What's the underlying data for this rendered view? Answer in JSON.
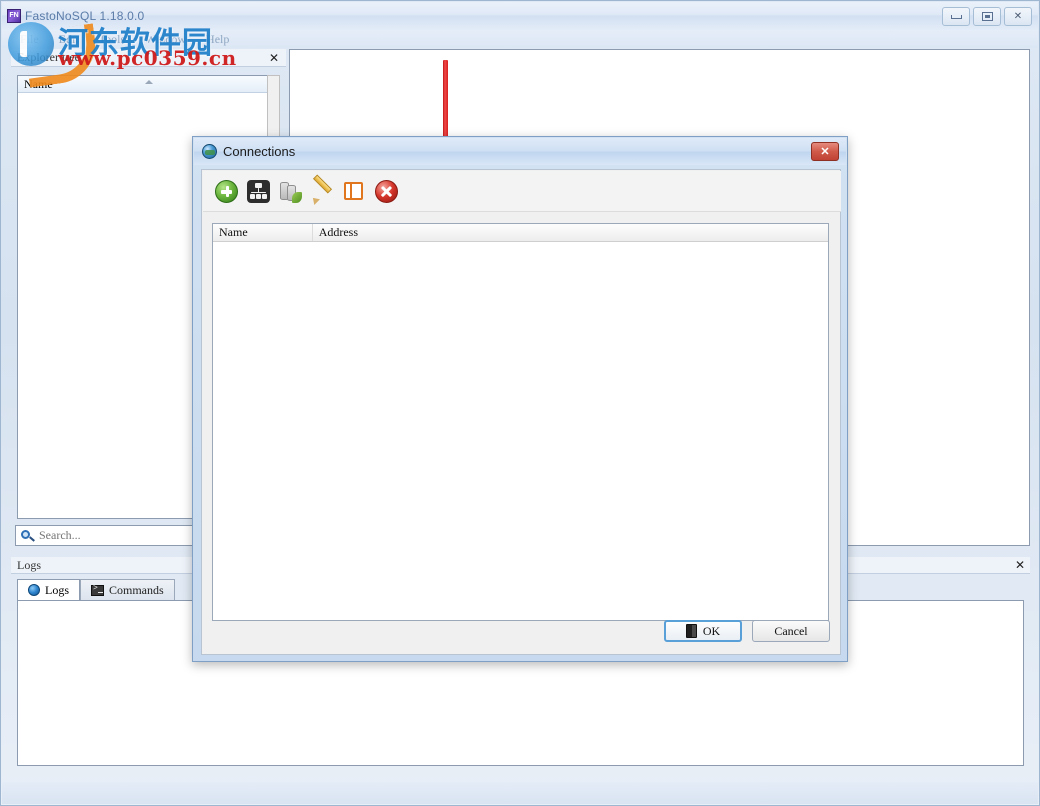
{
  "app": {
    "title": "FastoNoSQL 1.18.0.0",
    "title_icon": "app-icon",
    "window_controls": {
      "minimize": "minimize-button",
      "maximize": "maximize-button",
      "close_label": "✕"
    },
    "menu": [
      {
        "label": "File"
      },
      {
        "label": "Edit"
      },
      {
        "label": "Tools"
      },
      {
        "label": "Window"
      },
      {
        "label": "Help"
      }
    ]
  },
  "explorer": {
    "title": "Explorer tree",
    "close_label": "✕",
    "column_header": "Name",
    "rows": []
  },
  "search": {
    "value": "",
    "placeholder": "Search...",
    "icon": "search-icon"
  },
  "logs_panel": {
    "title": "Logs",
    "close_label": "✕",
    "tabs": [
      {
        "label": "Logs",
        "icon": "logs-icon",
        "active": true
      },
      {
        "label": "Commands",
        "icon": "console-icon",
        "active": false
      }
    ],
    "content": ""
  },
  "status_bar": {
    "text": ""
  },
  "watermark": {
    "site_name": "河东软件园",
    "url": "www.pc0359.cn",
    "brand_color": "#1d7ec9",
    "url_color": "#cf1b1b"
  },
  "annotation": {
    "type": "down-arrow",
    "color": "#de1f1f"
  },
  "dialog": {
    "title": "Connections",
    "icon": "globe-icon",
    "close_label": "✕",
    "toolbar": [
      {
        "name": "add-connection",
        "icon": "add-icon",
        "tooltip": "Add connection"
      },
      {
        "name": "add-cluster",
        "icon": "cluster-icon",
        "tooltip": "Add cluster"
      },
      {
        "name": "add-sentinel",
        "icon": "sentinel-icon",
        "tooltip": "Add sentinel"
      },
      {
        "name": "edit-connection",
        "icon": "pencil-icon",
        "tooltip": "Edit connection"
      },
      {
        "name": "clone-connection",
        "icon": "clone-icon",
        "tooltip": "Clone connection"
      },
      {
        "name": "remove-connection",
        "icon": "remove-icon",
        "tooltip": "Remove connection"
      }
    ],
    "table": {
      "columns": [
        "Name",
        "Address"
      ],
      "rows": []
    },
    "buttons": {
      "ok": "OK",
      "cancel": "Cancel"
    }
  }
}
